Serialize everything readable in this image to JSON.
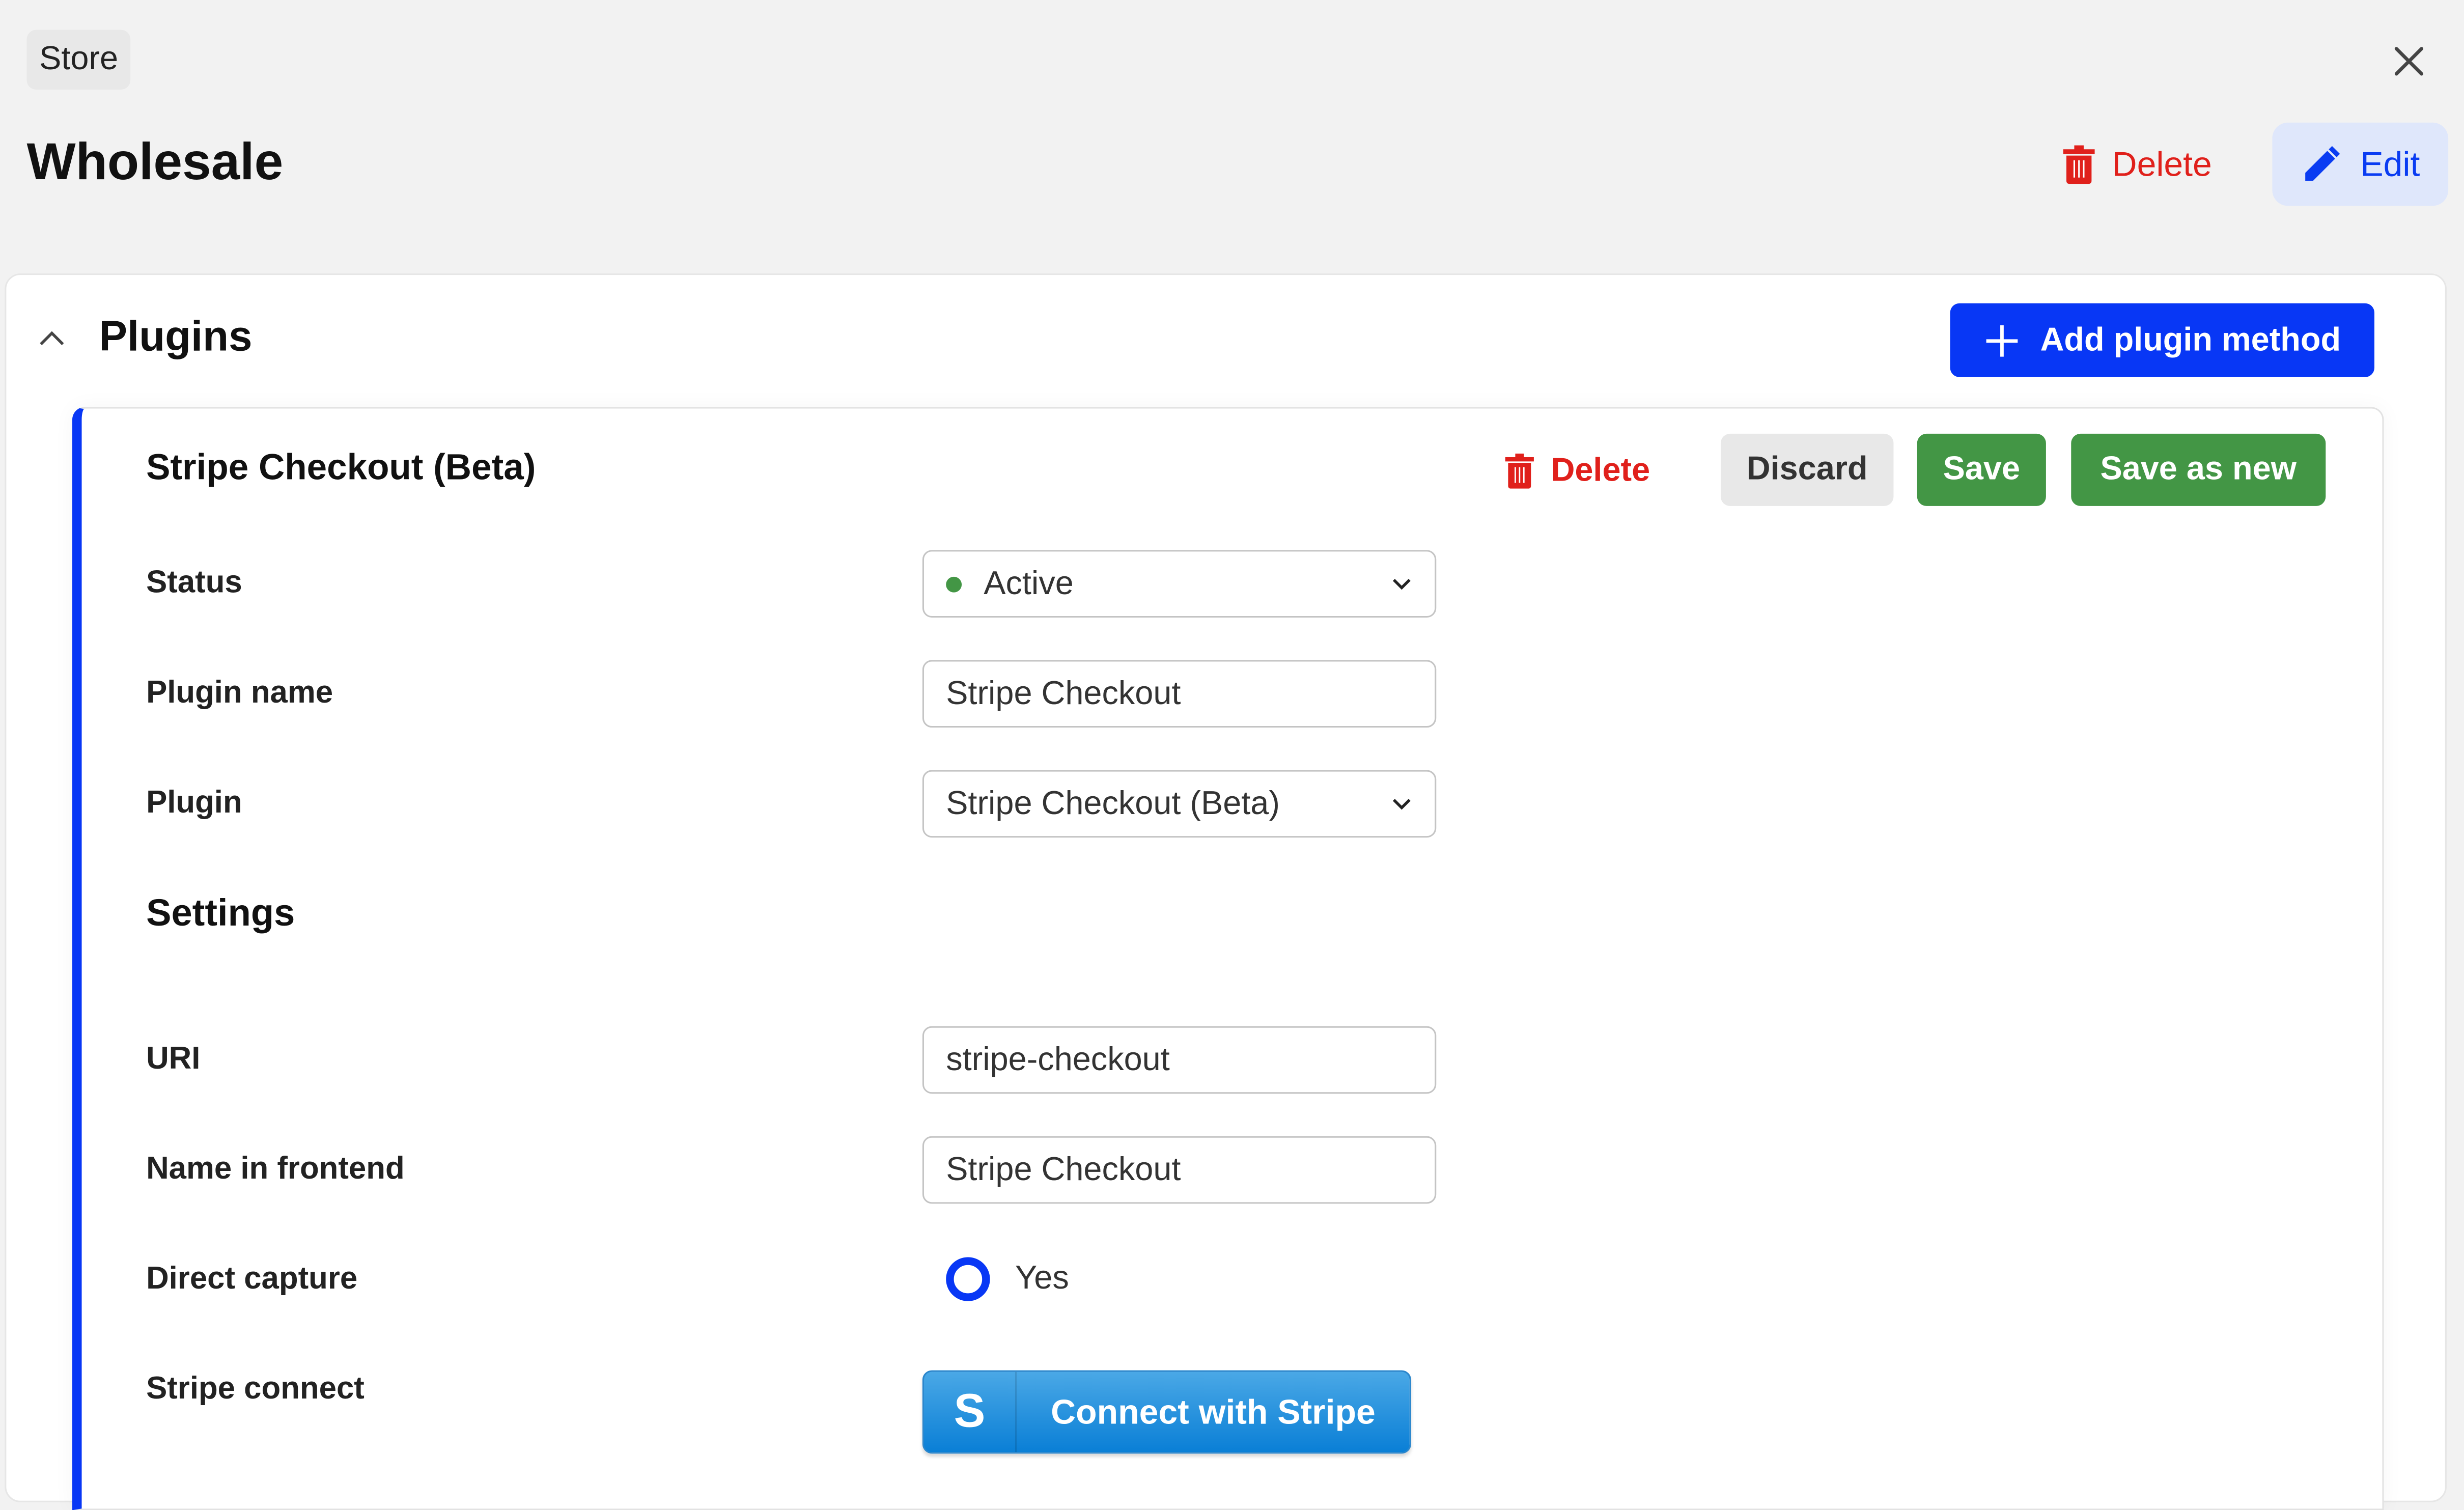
{
  "breadcrumb": "Store",
  "page_title": "Wholesale",
  "header_actions": {
    "delete": "Delete",
    "edit": "Edit"
  },
  "colors": {
    "accent": "#0837f5",
    "danger": "#e0201b",
    "success": "#439645",
    "stripe": "#1a8ddd"
  },
  "plugins_section": {
    "title": "Plugins",
    "add_button": "Add plugin method",
    "card": {
      "title": "Stripe Checkout (Beta)",
      "actions": {
        "delete": "Delete",
        "discard": "Discard",
        "save": "Save",
        "save_as_new": "Save as new"
      },
      "fields": {
        "status": {
          "label": "Status",
          "value": "Active"
        },
        "plugin_name": {
          "label": "Plugin name",
          "value": "Stripe Checkout"
        },
        "plugin": {
          "label": "Plugin",
          "value": "Stripe Checkout (Beta)"
        }
      },
      "settings_heading": "Settings",
      "settings": {
        "uri": {
          "label": "URI",
          "value": "stripe-checkout"
        },
        "name_in_frontend": {
          "label": "Name in frontend",
          "value": "Stripe Checkout"
        },
        "direct_capture": {
          "label": "Direct capture",
          "option": "Yes",
          "selected": true
        },
        "stripe_connect": {
          "label": "Stripe connect",
          "button": "Connect with Stripe",
          "logo": "S"
        }
      }
    }
  }
}
